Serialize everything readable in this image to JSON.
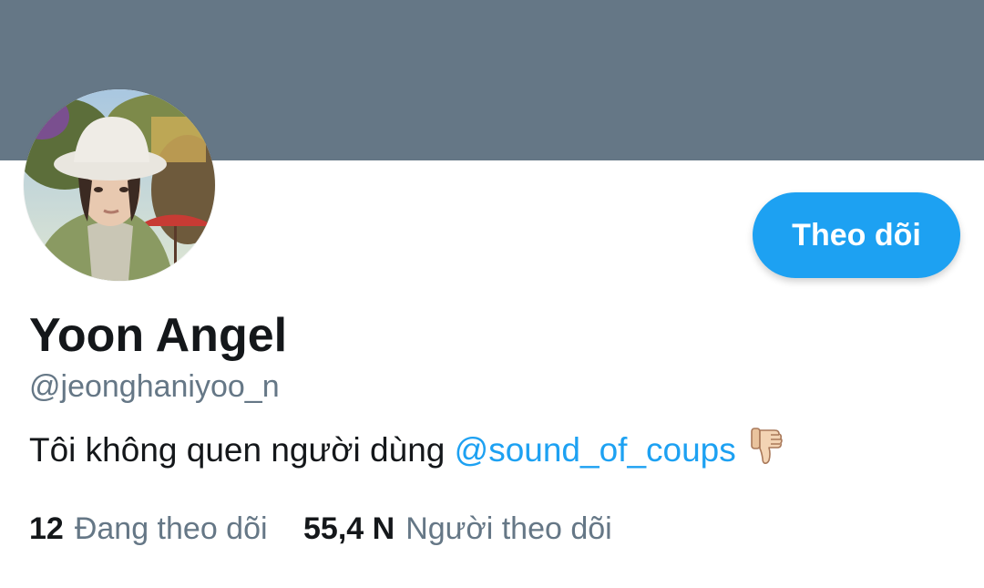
{
  "profile": {
    "display_name": "Yoon Angel",
    "handle": "@jeonghaniyoo_n",
    "bio_text": "Tôi không quen người dùng ",
    "bio_mention": "@sound_of_coups",
    "bio_emoji_icon": "thumbs-down-icon",
    "follow_label": "Theo dõi",
    "avatar_icon": "profile-photo"
  },
  "stats": {
    "following_count": "12",
    "following_label": "Đang theo dõi",
    "followers_count": "55,4 N",
    "followers_label": "Người theo dõi"
  },
  "colors": {
    "banner": "#657786",
    "accent": "#1da1f2",
    "text": "#14171a",
    "muted": "#657786"
  }
}
